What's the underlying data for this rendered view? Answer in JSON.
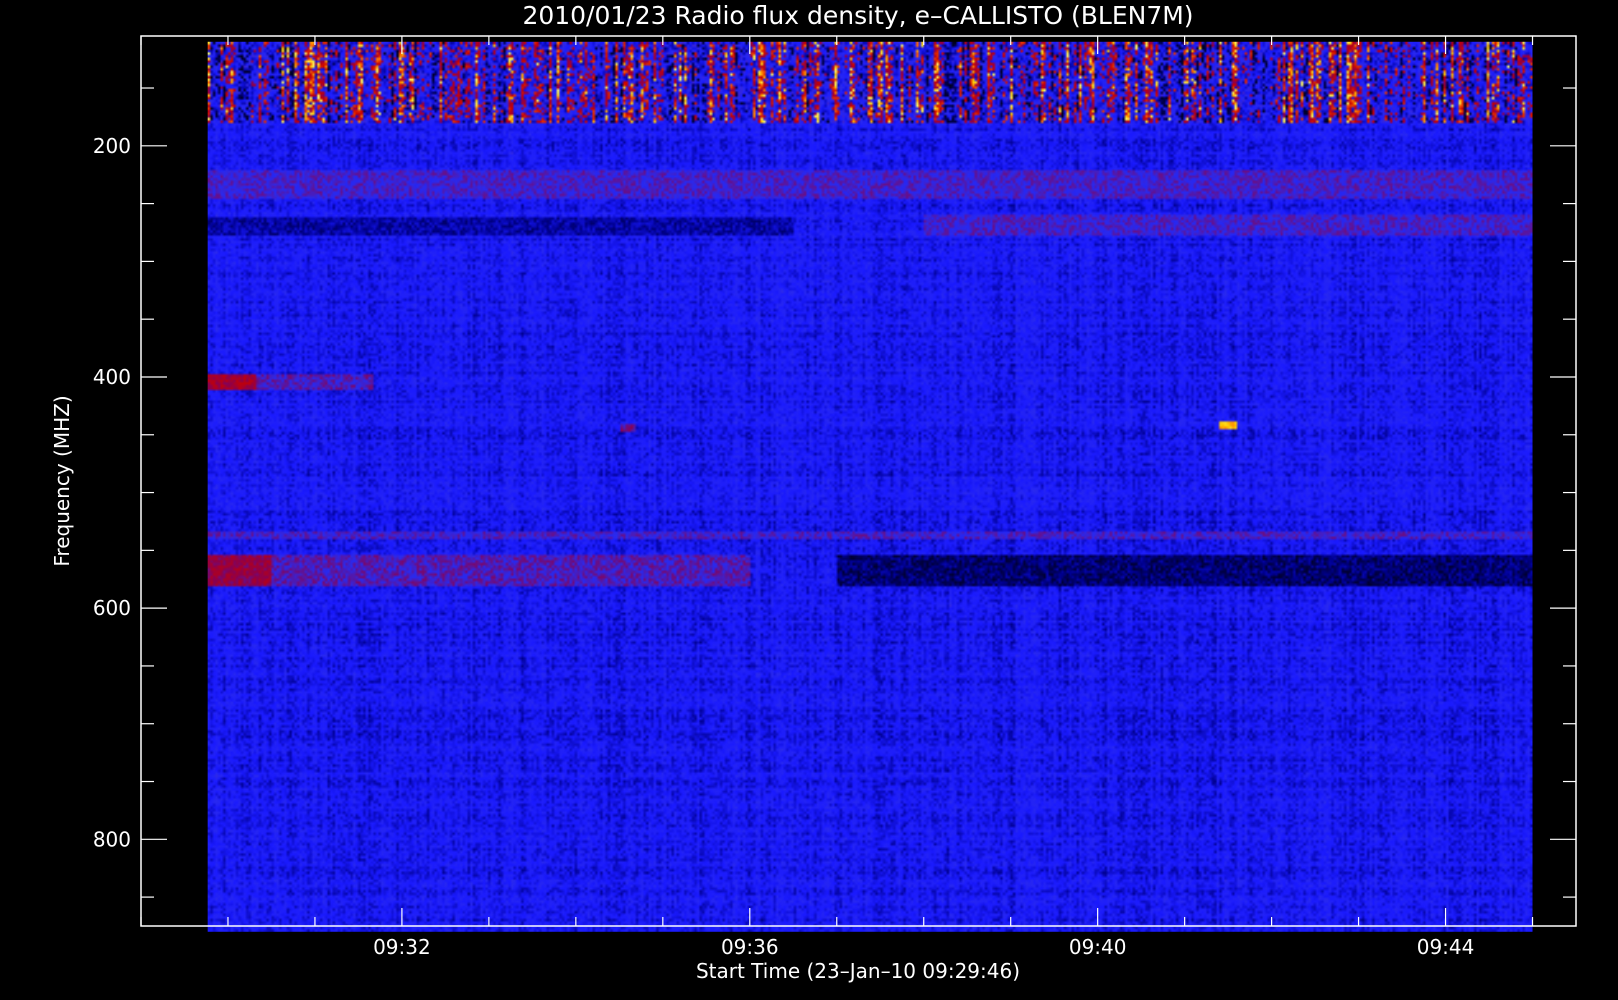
{
  "chart_data": {
    "type": "heatmap",
    "title": "2010/01/23  Radio flux density, e–CALLISTO (BLEN7M)",
    "xlabel": "Start Time (23–Jan–10 09:29:46)",
    "ylabel": "Frequency (MHZ)",
    "x_range": [
      "09:29:46",
      "09:45:00"
    ],
    "xlim": [
      "09:29:00",
      "09:45:30"
    ],
    "ylim": [
      875,
      105
    ],
    "y_reversed": true,
    "x_ticks": [
      "09:32",
      "09:36",
      "09:40",
      "09:44"
    ],
    "y_ticks": [
      200,
      400,
      600,
      800
    ],
    "y_data_range": [
      110,
      880
    ],
    "colormap": [
      "#000000",
      "#000090",
      "#1a1aff",
      "#2a2aee",
      "#8a0050",
      "#c80000",
      "#ff6000",
      "#ffd000",
      "#ffff70"
    ],
    "background_intensity": 0.25,
    "features": [
      {
        "label": "RFI band",
        "f_min": 110,
        "f_max": 180,
        "t_start": "09:29:46",
        "t_end": "09:45:00",
        "intensity": "variable high"
      },
      {
        "label": "band",
        "f_min": 220,
        "f_max": 245,
        "t_start": "09:29:46",
        "t_end": "09:45:00",
        "intensity": 0.4
      },
      {
        "label": "band",
        "f_min": 262,
        "f_max": 278,
        "t_start": "09:29:46",
        "t_end": "09:36:30",
        "intensity": 0.15
      },
      {
        "label": "band",
        "f_min": 260,
        "f_max": 278,
        "t_start": "09:38:00",
        "t_end": "09:45:00",
        "intensity": 0.4
      },
      {
        "label": "band",
        "f_min": 398,
        "f_max": 412,
        "t_start": "09:29:46",
        "t_end": "09:30:20",
        "intensity": 0.55
      },
      {
        "label": "band",
        "f_min": 398,
        "f_max": 412,
        "t_start": "09:30:20",
        "t_end": "09:31:40",
        "intensity": 0.42
      },
      {
        "label": "spot",
        "f_min": 440,
        "f_max": 448,
        "t_start": "09:34:30",
        "t_end": "09:34:42",
        "intensity": 0.45
      },
      {
        "label": "spot",
        "f_min": 438,
        "f_max": 446,
        "t_start": "09:41:24",
        "t_end": "09:41:36",
        "intensity": 0.85
      },
      {
        "label": "line",
        "f_min": 533,
        "f_max": 541,
        "t_start": "09:29:46",
        "t_end": "09:45:00",
        "intensity": 0.4
      },
      {
        "label": "band",
        "f_min": 555,
        "f_max": 582,
        "t_start": "09:29:46",
        "t_end": "09:30:30",
        "intensity": 0.52
      },
      {
        "label": "band",
        "f_min": 555,
        "f_max": 582,
        "t_start": "09:30:30",
        "t_end": "09:36:00",
        "intensity": 0.42
      },
      {
        "label": "band",
        "f_min": 555,
        "f_max": 582,
        "t_start": "09:37:00",
        "t_end": "09:45:00",
        "intensity": 0.1
      }
    ]
  }
}
